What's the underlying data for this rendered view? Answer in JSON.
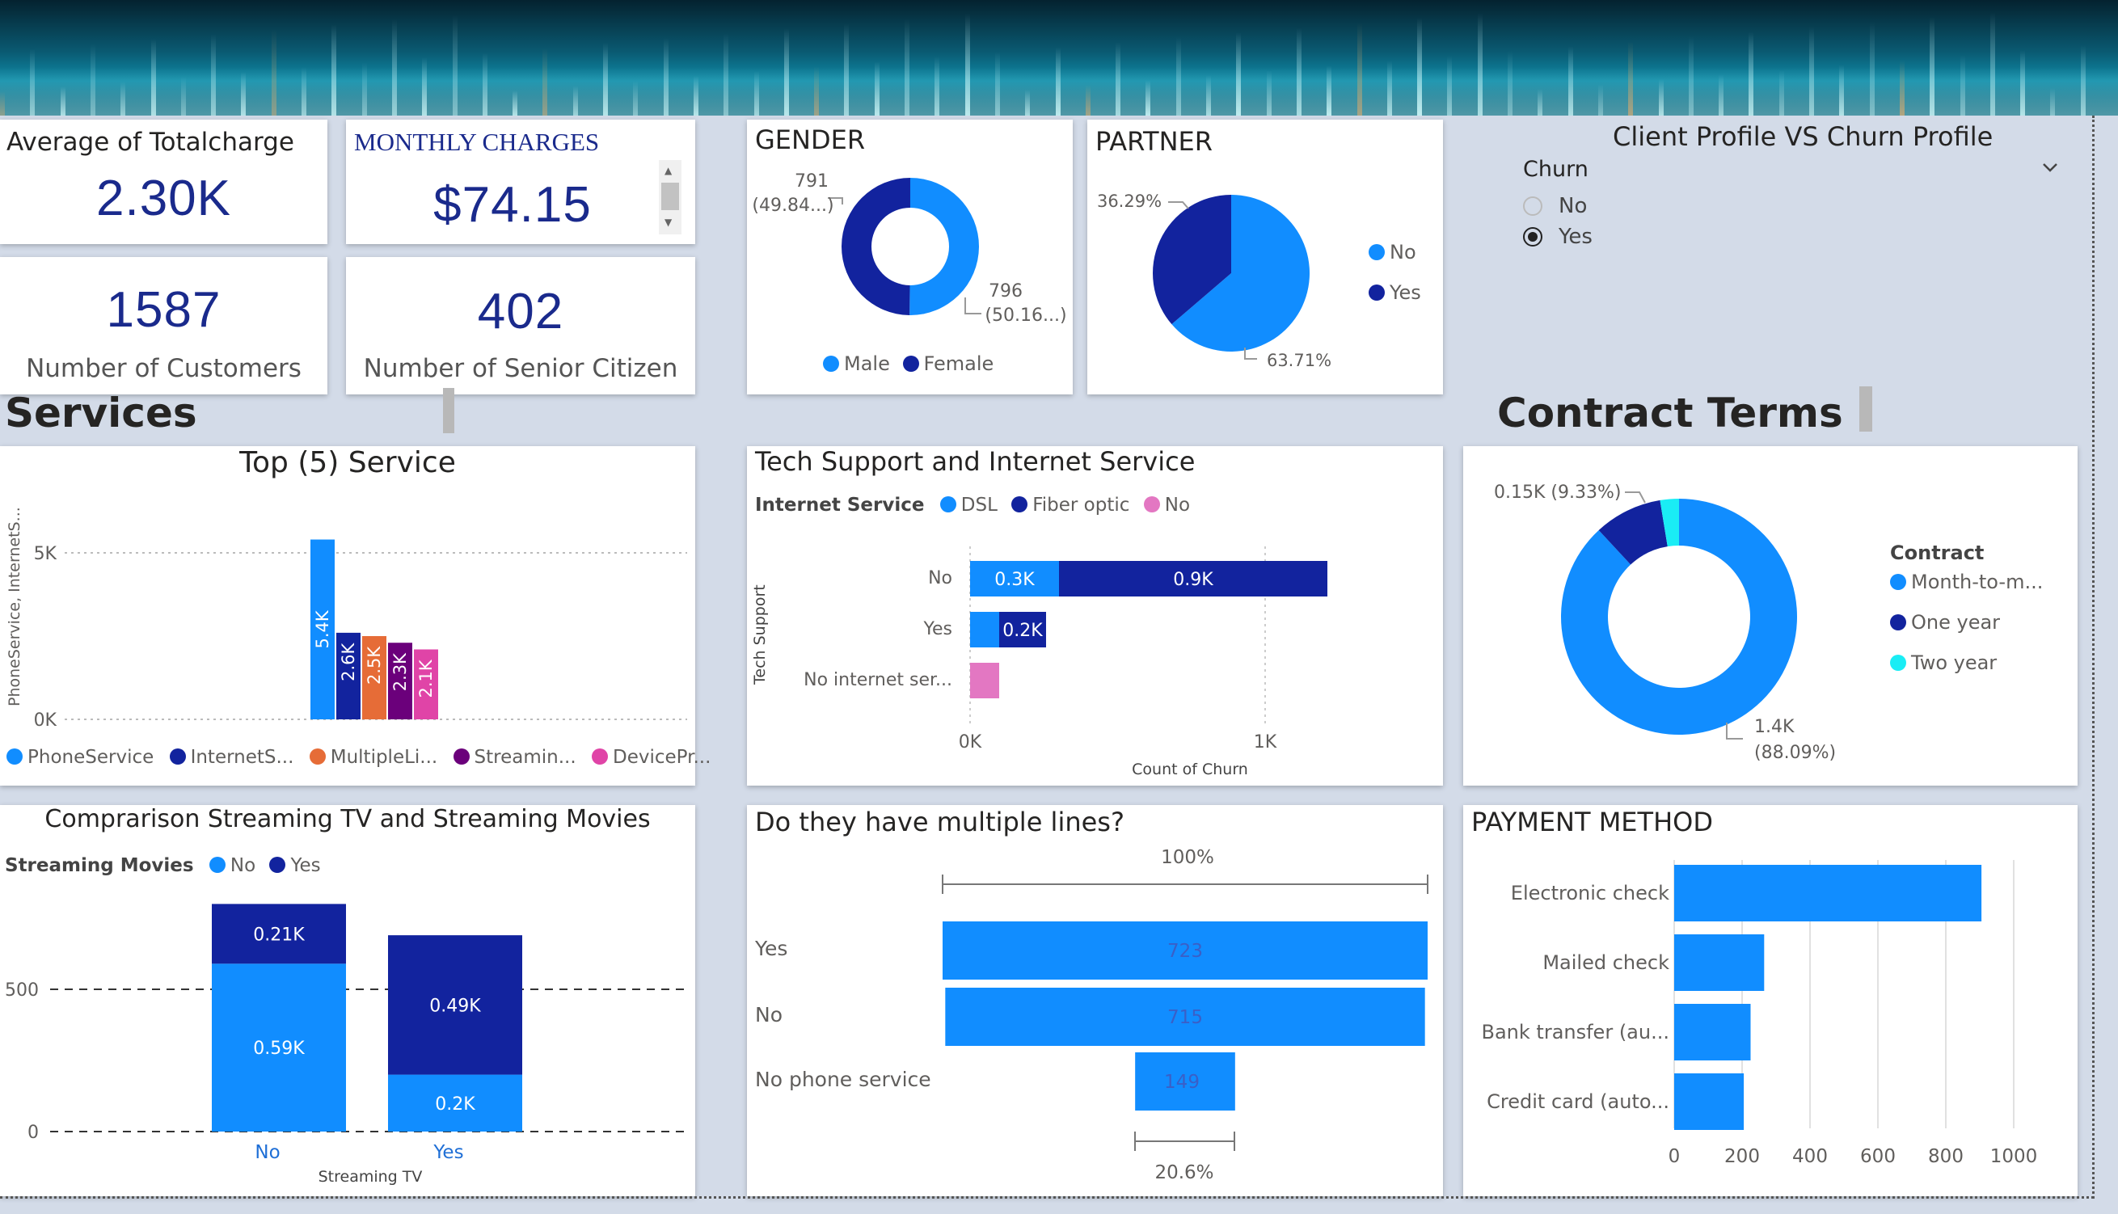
{
  "colors": {
    "blue": "#118dff",
    "navy": "#12239e",
    "orange": "#e66c37",
    "purple": "#6b007b",
    "pink": "#e044a7",
    "cyan": "#1aedf5",
    "lightpink": "#e377c2",
    "kpi": "#1a2a8c"
  },
  "kpis": {
    "avg_totalcharge": {
      "title": "Average of Totalcharge",
      "value": "2.30K"
    },
    "monthly_charges": {
      "title": "MONTHLY CHARGES",
      "value": "$74.15"
    },
    "customers": {
      "value": "1587",
      "label": "Number of Customers"
    },
    "senior": {
      "value": "402",
      "label": "Number of Senior Citizen"
    }
  },
  "gender": {
    "title": "GENDER",
    "male_label_line1": "791",
    "male_label_line2": "(49.84...)",
    "female_label_line1": "796",
    "female_label_line2": "(50.16...)",
    "legend": [
      "Male",
      "Female"
    ],
    "chart_data": {
      "type": "pie",
      "variant": "donut",
      "categories": [
        "Male",
        "Female"
      ],
      "values": [
        791,
        796
      ]
    }
  },
  "partner": {
    "title": "PARTNER",
    "label_yes": "36.29%",
    "label_no": "63.71%",
    "legend": [
      "No",
      "Yes"
    ],
    "chart_data": {
      "type": "pie",
      "categories": [
        "No",
        "Yes"
      ],
      "values": [
        63.71,
        36.29
      ]
    }
  },
  "slicer": {
    "title": "Client Profile VS Churn Profile",
    "field": "Churn",
    "options": [
      {
        "label": "No",
        "selected": false
      },
      {
        "label": "Yes",
        "selected": true
      }
    ],
    "chevron": "chevron-down-icon"
  },
  "sections": {
    "services": "Services",
    "contract": "Contract Terms"
  },
  "top5": {
    "title": "Top (5) Service",
    "ylabel": "PhoneService, InternetS...",
    "ticks": [
      "5K",
      "0K"
    ],
    "bar_labels": [
      "5.4K",
      "2.6K",
      "2.5K",
      "2.3K",
      "2.1K"
    ],
    "legend": [
      "PhoneService",
      "InternetS...",
      "MultipleLi...",
      "Streamin...",
      "DevicePr..."
    ],
    "chart_data": {
      "type": "bar",
      "categories": [
        "PhoneService",
        "InternetS...",
        "MultipleLi...",
        "Streamin...",
        "DevicePr..."
      ],
      "values": [
        5400,
        2600,
        2500,
        2300,
        2100
      ],
      "ylim": [
        0,
        5800
      ]
    }
  },
  "tech": {
    "title": "Tech Support and Internet Service",
    "legend_title": "Internet Service",
    "legend": [
      "DSL",
      "Fiber optic",
      "No"
    ],
    "ylabel": "Tech Support",
    "xlabel": "Count of Churn",
    "xticks": [
      "0K",
      "1K"
    ],
    "chart_data": {
      "type": "bar",
      "orientation": "horizontal",
      "stacked": true,
      "categories": [
        "No",
        "Yes",
        "No internet ser..."
      ],
      "series": [
        {
          "name": "DSL",
          "values": [
            300,
            100,
            0
          ],
          "labels": [
            "0.3K",
            "",
            ""
          ]
        },
        {
          "name": "Fiber optic",
          "values": [
            900,
            200,
            0
          ],
          "labels": [
            "0.9K",
            "0.2K",
            ""
          ]
        },
        {
          "name": "No",
          "values": [
            0,
            0,
            100
          ],
          "labels": [
            "",
            "",
            ""
          ]
        }
      ],
      "xlim": [
        0,
        1450
      ]
    }
  },
  "contract": {
    "legend_title": "Contract",
    "legend": [
      "Month-to-m...",
      "One year",
      "Two year"
    ],
    "label_small": "0.15K (9.33%)",
    "label_big_line1": "1.4K",
    "label_big_line2": "(88.09%)",
    "chart_data": {
      "type": "pie",
      "variant": "donut",
      "categories": [
        "Month-to-m...",
        "One year",
        "Two year"
      ],
      "values": [
        88.09,
        9.33,
        2.58
      ]
    }
  },
  "streaming": {
    "title": "Comprarison Streaming TV and Streaming Movies",
    "legend_title": "Streaming Movies",
    "legend": [
      "No",
      "Yes"
    ],
    "yticks": [
      "500",
      "0"
    ],
    "xlabel": "Streaming TV",
    "categories": [
      "No",
      "Yes"
    ],
    "labels": {
      "no_no": "0.59K",
      "no_yes": "0.21K",
      "yes_no": "0.2K",
      "yes_yes": "0.49K"
    },
    "chart_data": {
      "type": "bar",
      "stacked": true,
      "categories": [
        "No",
        "Yes"
      ],
      "series": [
        {
          "name": "No",
          "values": [
            590,
            200
          ]
        },
        {
          "name": "Yes",
          "values": [
            210,
            490
          ]
        }
      ],
      "ylim": [
        0,
        820
      ]
    }
  },
  "lines": {
    "title": "Do they have multiple lines?",
    "top_pct": "100%",
    "bottom_pct": "20.6%",
    "chart_data": {
      "type": "bar",
      "variant": "funnel",
      "categories": [
        "Yes",
        "No",
        "No phone service"
      ],
      "values": [
        723,
        715,
        149
      ]
    }
  },
  "payment": {
    "title": "PAYMENT METHOD",
    "xticks": [
      "0",
      "200",
      "400",
      "600",
      "800",
      "1000"
    ],
    "chart_data": {
      "type": "bar",
      "orientation": "horizontal",
      "categories": [
        "Electronic check",
        "Mailed check",
        "Bank transfer (au...",
        "Credit card (auto..."
      ],
      "values": [
        905,
        265,
        225,
        205
      ],
      "xlim": [
        0,
        1000
      ]
    }
  }
}
